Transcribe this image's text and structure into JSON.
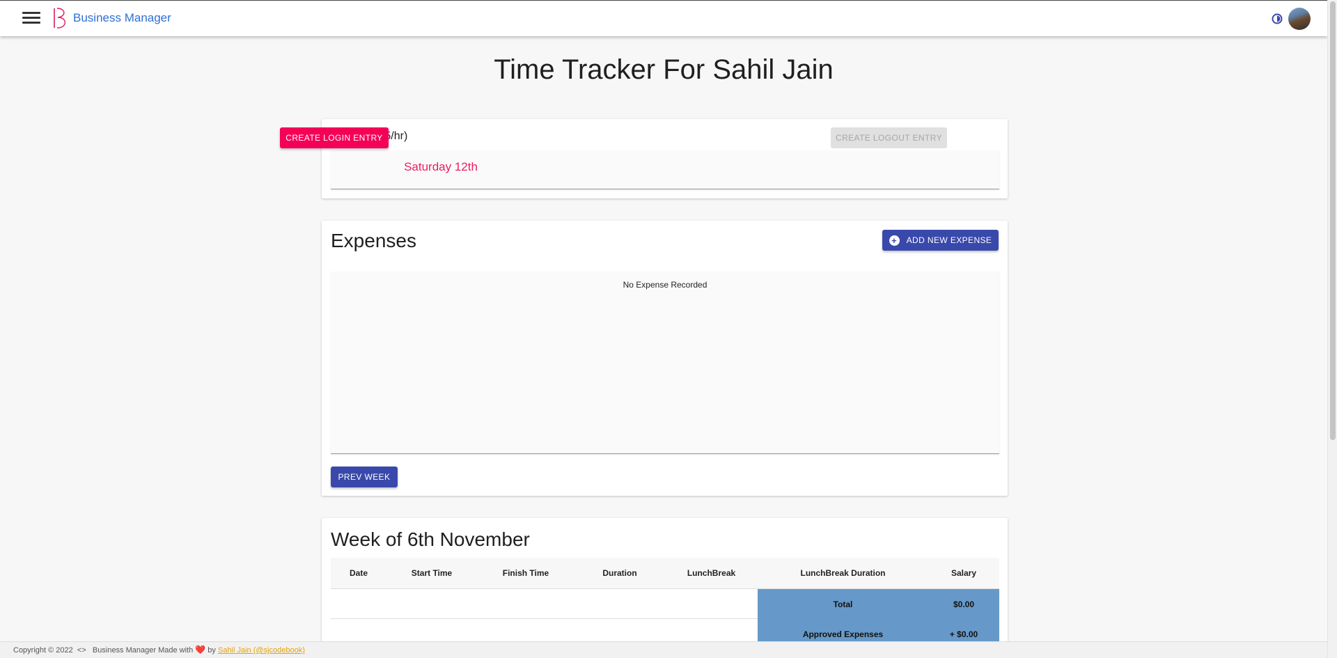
{
  "header": {
    "app_name": "Business Manager",
    "icons": [
      "menu-icon",
      "brand-logo",
      "theme-toggle-icon",
      "avatar"
    ]
  },
  "page": {
    "title": "Time Tracker For Sahil Jain"
  },
  "time_entry": {
    "salary_label": "(Salary: $15/hr)",
    "day_label": "Saturday 12th",
    "create_login_label": "CREATE LOGIN ENTRY",
    "create_logout_label": "CREATE LOGOUT ENTRY"
  },
  "expenses": {
    "title": "Expenses",
    "add_button_label": "ADD NEW EXPENSE",
    "empty_text": "No Expense Recorded",
    "prev_week_label": "PREV WEEK"
  },
  "week": {
    "title": "Week of 6th November",
    "columns": [
      "Date",
      "Start Time",
      "Finish Time",
      "Duration",
      "LunchBreak",
      "LunchBreak Duration",
      "Salary"
    ],
    "summary": [
      {
        "label": "Total",
        "value": "$0.00"
      },
      {
        "label": "Approved Expenses",
        "value": "+ $0.00"
      }
    ]
  },
  "footer": {
    "copyright": "Copyright © 2022",
    "code_glyph": "<>",
    "made_with": "Business Manager Made with",
    "heart": "❤️",
    "by": "by",
    "author_link": "Sahil Jain (@sjcodebook)"
  },
  "colors": {
    "brand_blue": "#2f6fd6",
    "accent_pink": "#f50057",
    "primary_indigo": "#3949ab",
    "summary_cell": "#6699c9"
  }
}
